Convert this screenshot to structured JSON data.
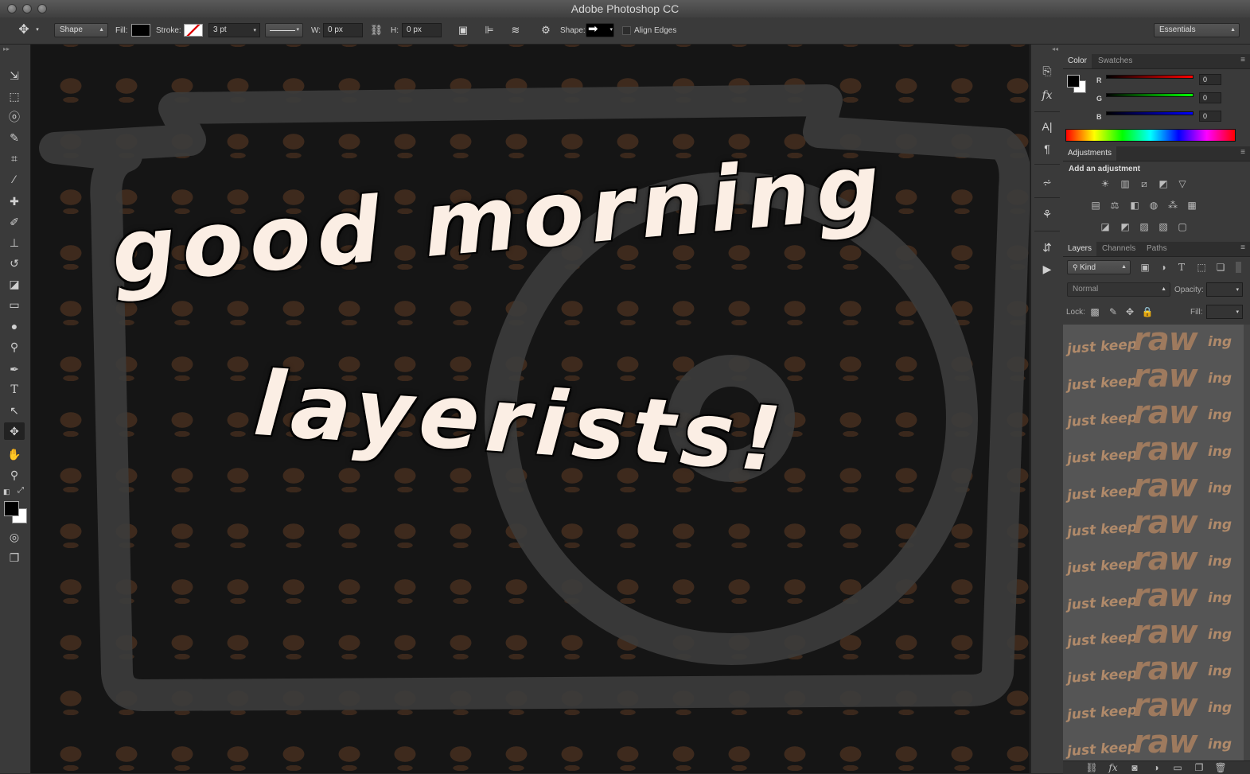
{
  "window": {
    "title": "Adobe Photoshop CC"
  },
  "options_bar": {
    "tool_mode": "Shape",
    "fill_label": "Fill:",
    "stroke_label": "Stroke:",
    "stroke_width": "3 pt",
    "w_label": "W:",
    "w_value": "0 px",
    "h_label": "H:",
    "h_value": "0 px",
    "shape_label": "Shape:",
    "align_edges_label": "Align Edges",
    "workspace": "Essentials"
  },
  "canvas": {
    "line1": "good morning",
    "line2": "layerists!"
  },
  "color_panel": {
    "tabs": [
      "Color",
      "Swatches"
    ],
    "r_label": "R",
    "r_value": "0",
    "g_label": "G",
    "g_value": "0",
    "b_label": "B",
    "b_value": "0"
  },
  "adjustments_panel": {
    "tab": "Adjustments",
    "heading": "Add an adjustment"
  },
  "layers_panel": {
    "tabs": [
      "Layers",
      "Channels",
      "Paths"
    ],
    "filter_kind": "Kind",
    "blend_mode": "Normal",
    "opacity_label": "Opacity:",
    "lock_label": "Lock:",
    "fill_label": "Fill:",
    "thumb_text_small": "just keep",
    "thumb_text_big": "raw",
    "thumb_text_suffix": "ing"
  },
  "colors": {
    "foreground": "#000000",
    "background": "#ffffff",
    "text_fill": "#fbeee4",
    "coffee_brown": "#78482a"
  }
}
